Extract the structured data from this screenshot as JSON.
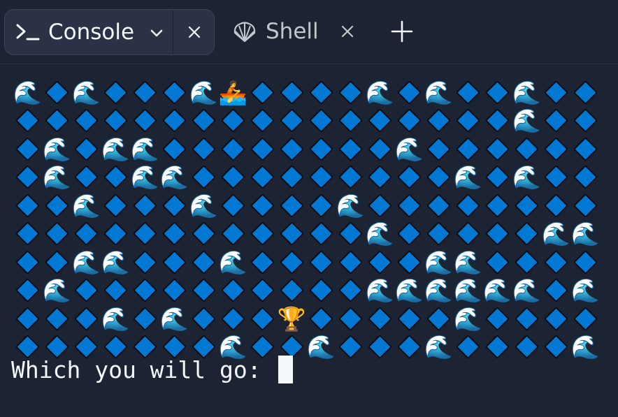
{
  "tabs": {
    "console": {
      "label": "Console",
      "icon": "prompt-icon"
    },
    "shell": {
      "label": "Shell",
      "icon": "shell-icon"
    }
  },
  "console": {
    "prompt": "Which you will go: ",
    "legend": {
      "W": "🌊",
      "D": "water-tile",
      "B": "🚣",
      "T": "🏆"
    },
    "grid": [
      "WDWDDDWBDDDDWDWDDWDD",
      "DDDDDDDDDDDDDDDDDWDD",
      "DWDWWDDDDDDDDWDDDDDD",
      "DWDDWWDDDDDDDDDWDWDD",
      "DDWDDDWDDDDWDDDDDDDD",
      "DDDDDDDDDDDDWDDDDDWW",
      "DDWWDDDWDDDDDDWWDDDD",
      "DWDDDDDDDDDDWWWWWWDW",
      "DDDWDWDDDTDDDDDWDDDD",
      "DDDDDDDWDDWDDDWDDDDW"
    ]
  },
  "colors": {
    "background": "#1c2333",
    "tab_active": "#2b3245",
    "water": "#0078d4",
    "text": "#f5f9fc"
  }
}
